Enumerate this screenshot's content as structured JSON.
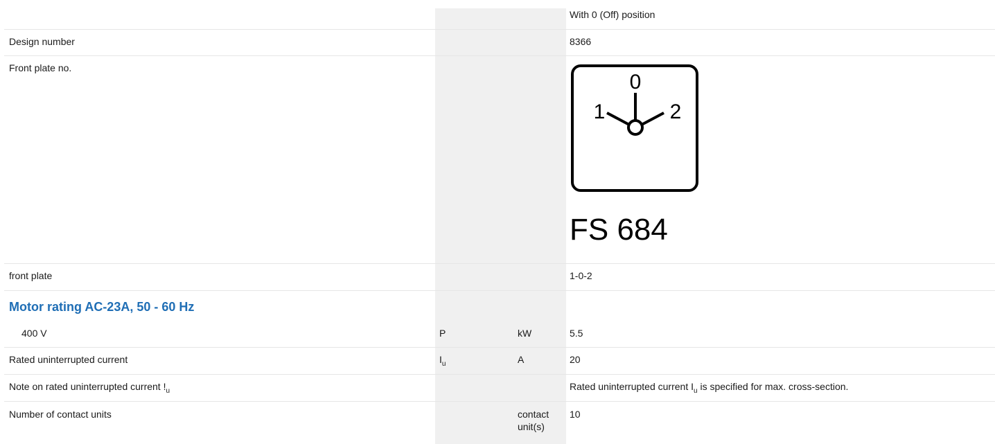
{
  "rows": {
    "position": {
      "value": "With 0 (Off) position"
    },
    "design_number": {
      "label": "Design number",
      "value": "8366"
    },
    "front_plate_no": {
      "label": "Front plate no.",
      "image_code": "FS 684",
      "dial_labels": {
        "left": "1",
        "center": "0",
        "right": "2"
      }
    },
    "front_plate": {
      "label": "front plate",
      "value": "1-0-2"
    },
    "section_heading": "Motor rating AC-23A, 50 - 60 Hz",
    "motor_400v": {
      "label": "400 V",
      "symbol": "P",
      "unit": "kW",
      "value": "5.5"
    },
    "rated_current": {
      "label": "Rated uninterrupted current",
      "symbol_main": "I",
      "symbol_sub": "u",
      "unit": "A",
      "value": "20"
    },
    "note_current": {
      "label_main": "Note on rated uninterrupted current !",
      "label_sub": "u",
      "value_pre": "Rated uninterrupted current I",
      "value_sub": "u",
      "value_post": " is specified for max. cross-section."
    },
    "contact_units": {
      "label": "Number of contact units",
      "unit_line1": "contact",
      "unit_line2": "unit(s)",
      "value": "10"
    }
  }
}
